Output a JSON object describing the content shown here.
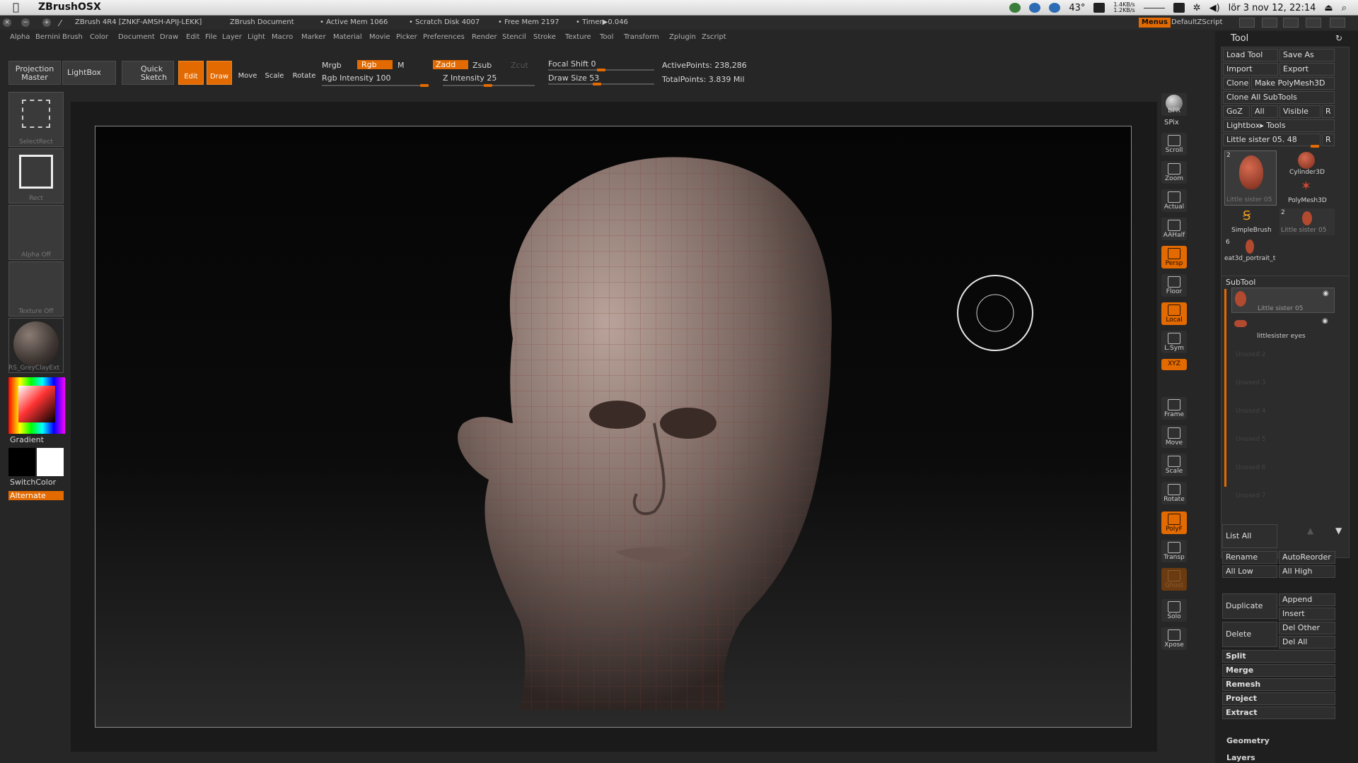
{
  "macbar": {
    "app_name": "ZBrushOSX",
    "temperature": "43°",
    "net_up": "1.4KB/s",
    "net_down": "1.2KB/s",
    "datetime": "lör 3 nov 12, 22:14"
  },
  "titlebar": {
    "title": "ZBrush 4R4 [ZNKF-AMSH-APIJ-LEKK]",
    "document": "ZBrush Document",
    "active_mem": "• Active Mem 1066",
    "scratch": "• Scratch Disk 4007",
    "free_mem": "• Free Mem 2197",
    "timer": "• Timer▶0.046",
    "menus_label": "Menus",
    "script_label": "DefaultZScript"
  },
  "menu": [
    "Alpha",
    "Bernini",
    "Brush",
    "Color",
    "Document",
    "Draw",
    "Edit",
    "File",
    "Layer",
    "Light",
    "Macro",
    "Marker",
    "Material",
    "Movie",
    "Picker",
    "Preferences",
    "Render",
    "Stencil",
    "Stroke",
    "Texture",
    "Tool",
    "Transform",
    "Zplugin",
    "Zscript"
  ],
  "shelf": {
    "projection_master": "Projection Master",
    "lightbox": "LightBox",
    "quick_sketch": "Quick Sketch",
    "edit": "Edit",
    "draw": "Draw",
    "move": "Move",
    "scale": "Scale",
    "rotate": "Rotate",
    "mrgb": "Mrgb",
    "rgb": "Rgb",
    "m": "M",
    "zadd": "Zadd",
    "zsub": "Zsub",
    "zcut": "Zcut",
    "rgb_intensity": "Rgb Intensity 100",
    "z_intensity": "Z Intensity 25",
    "focal_shift": "Focal Shift 0",
    "draw_size": "Draw Size 53",
    "active_points": "ActivePoints: 238,286",
    "total_points": "TotalPoints: 3.839 Mil"
  },
  "left": {
    "select_rect": "SelectRect",
    "rect": "Rect",
    "alpha": "Alpha Off",
    "texture": "Texture Off",
    "material": "RS_GreyClayExt",
    "gradient": "Gradient",
    "switch_color": "SwitchColor",
    "alternate": "Alternate"
  },
  "rightcol": {
    "bpr": "BPR",
    "spix": "SPix",
    "scroll": "Scroll",
    "zoom": "Zoom",
    "actual": "Actual",
    "aahalf": "AAHalf",
    "persp": "Persp",
    "floor": "Floor",
    "local": "Local",
    "lsym": "L.Sym",
    "xyz": "XYZ",
    "frame": "Frame",
    "move": "Move",
    "scale": "Scale",
    "rotate": "Rotate",
    "polyf": "PolyF",
    "transp": "Transp",
    "ghost": "Ghost",
    "solo": "Solo",
    "xpose": "Xpose"
  },
  "tool": {
    "title": "Tool",
    "load_tool": "Load Tool",
    "save_as": "Save As",
    "import": "Import",
    "export": "Export",
    "clone": "Clone",
    "make_polymesh": "Make PolyMesh3D",
    "clone_all": "Clone All SubTools",
    "goz": "GoZ",
    "all": "All",
    "visible": "Visible",
    "r": "R",
    "lightbox_tools": "Lightbox▸ Tools",
    "current_tool": "Little sister 05. 48",
    "tools": [
      {
        "count": "2",
        "name": "Little sister 05"
      },
      {
        "count": "",
        "name": "Cylinder3D"
      },
      {
        "count": "",
        "name": "PolyMesh3D"
      },
      {
        "count": "",
        "name": "SimpleBrush"
      },
      {
        "count": "2",
        "name": "Little sister 05"
      },
      {
        "count": "6",
        "name": "eat3d_portrait_t"
      }
    ],
    "subtool_title": "SubTool",
    "subtools": [
      "Little sister 05",
      "littlesister eyes"
    ],
    "unused": [
      "Unused 2",
      "Unused 3",
      "Unused 4",
      "Unused 5",
      "Unused 6",
      "Unused 7"
    ],
    "list_all": "List All",
    "rename": "Rename",
    "auto_reorder": "AutoReorder",
    "all_low": "All Low",
    "all_high": "All High",
    "duplicate": "Duplicate",
    "append": "Append",
    "insert": "Insert",
    "delete": "Delete",
    "del_other": "Del Other",
    "del_all": "Del All",
    "split": "Split",
    "merge": "Merge",
    "remesh": "Remesh",
    "project": "Project",
    "extract": "Extract",
    "geometry": "Geometry",
    "layers": "Layers"
  },
  "colors": {
    "accent": "#e36a00",
    "bg": "#262626"
  }
}
